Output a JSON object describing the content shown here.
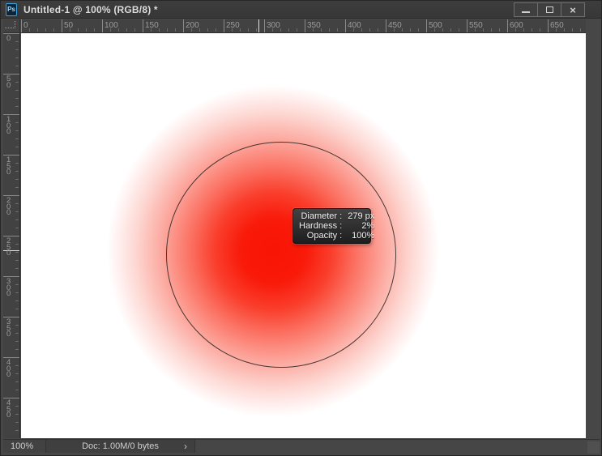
{
  "window": {
    "title": "Untitled-1 @ 100% (RGB/8) *",
    "app_icon_label": "Ps",
    "controls": {
      "close_glyph": "×"
    }
  },
  "rulers": {
    "unit": "px",
    "label_spacing_px": 50,
    "top_labels": [
      "0",
      "50",
      "100",
      "150",
      "200",
      "250",
      "300",
      "350",
      "400",
      "450",
      "500",
      "550",
      "600",
      "650"
    ],
    "left_labels": [
      "0",
      "50",
      "100",
      "150",
      "200",
      "250",
      "300",
      "350",
      "400",
      "450"
    ],
    "cursor_marker_x_label": "293",
    "cursor_marker_y_label": "268"
  },
  "brush_hud": {
    "rows": [
      {
        "label": "Diameter :",
        "value": "279 px"
      },
      {
        "label": "Hardness :",
        "value": "2%"
      },
      {
        "label": "Opacity :",
        "value": "100%"
      }
    ]
  },
  "statusbar": {
    "zoom": "100%",
    "doc_info": "Doc: 1.00M/0 bytes",
    "chevron": "›"
  },
  "colors": {
    "brush_red": "#f91405",
    "canvas_white": "#ffffff",
    "frame_gray": "#474747",
    "accent_blue": "#3ca5e0"
  }
}
